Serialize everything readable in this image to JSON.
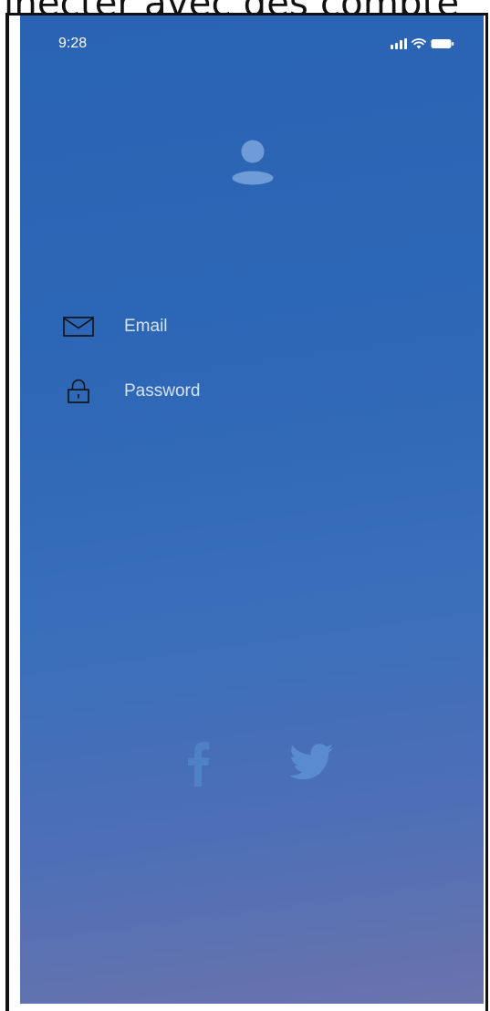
{
  "caption": "inecter avec des compte",
  "status_bar": {
    "time": "9:28",
    "icons": [
      "signal-icon",
      "wifi-icon",
      "battery-icon"
    ]
  },
  "login": {
    "avatar_icon": "user-icon",
    "email": {
      "icon": "envelope-icon",
      "placeholder": "Email",
      "value": ""
    },
    "password": {
      "icon": "lock-icon",
      "placeholder": "Password",
      "value": ""
    }
  },
  "social": {
    "facebook_icon": "facebook-icon",
    "twitter_icon": "twitter-icon"
  },
  "colors": {
    "gradient_top": "#2a63b3",
    "gradient_bottom": "#6b73ac",
    "icon_faded": "#6f9cd6",
    "text": "#ffffff"
  }
}
